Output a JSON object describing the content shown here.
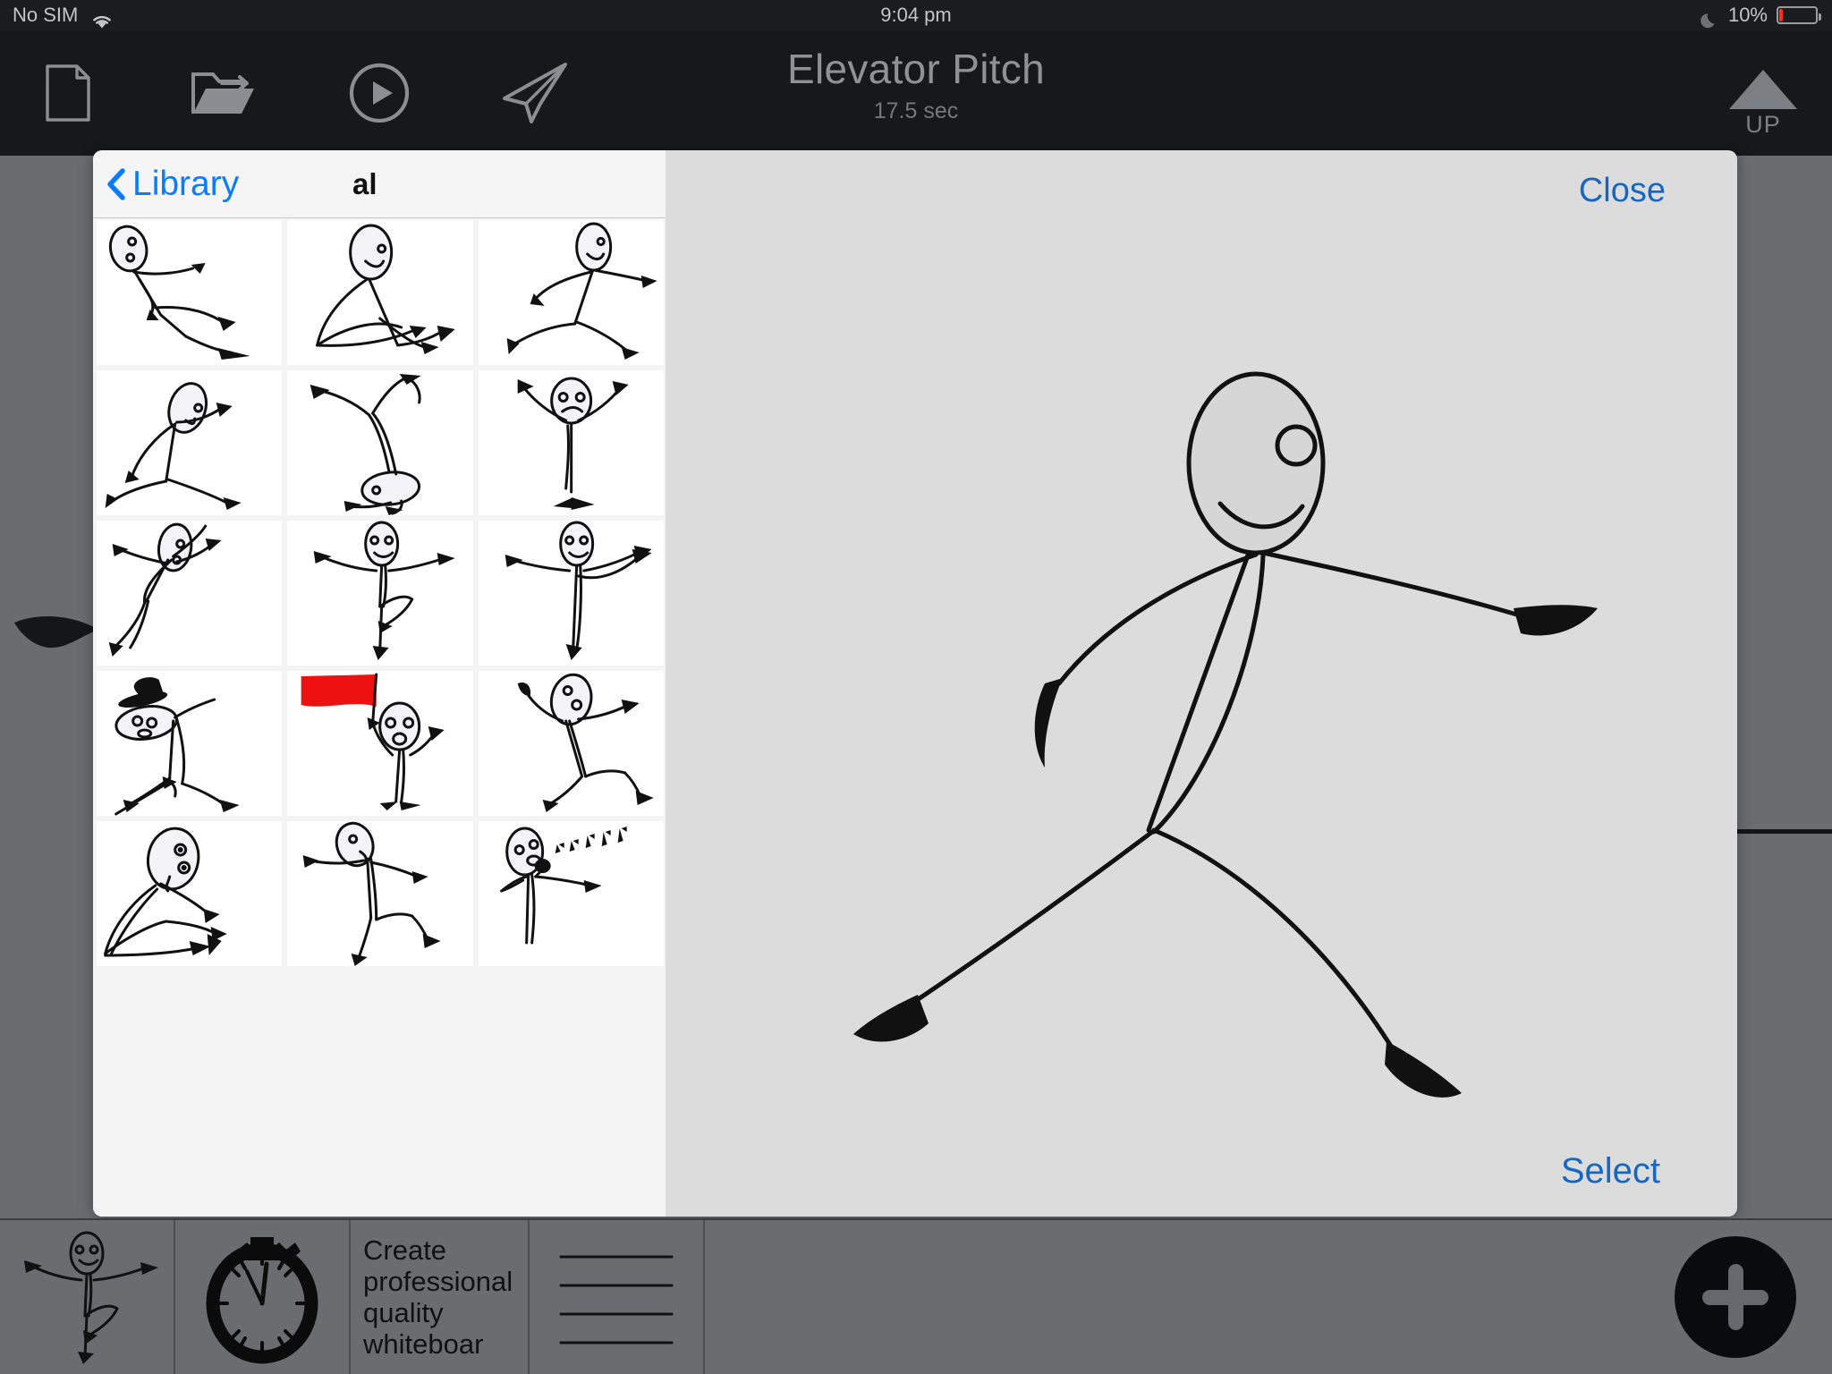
{
  "statusbar": {
    "carrier": "No SIM",
    "time": "9:04 pm",
    "battery_percent": "10%",
    "battery_level": 10,
    "wifi_icon": "wifi-icon",
    "dnd_icon": "moon-icon",
    "battery_icon": "battery-icon"
  },
  "toolbar": {
    "new_icon": "new-document-icon",
    "open_icon": "open-folder-icon",
    "play_icon": "play-circle-icon",
    "send_icon": "paper-plane-icon",
    "up_label": "UP",
    "up_icon": "triangle-up-icon"
  },
  "document": {
    "title": "Elevator Pitch",
    "duration": "17.5 sec"
  },
  "modal": {
    "back_label": "Library",
    "back_icon": "chevron-left-icon",
    "panel_title": "al",
    "close_label": "Close",
    "select_label": "Select",
    "accent_blue": "#0a7cff",
    "action_blue": "#1667c4",
    "thumbnails": [
      {
        "id": "thumb-1",
        "name": "falling-back-figure"
      },
      {
        "id": "thumb-2",
        "name": "sitting-figure"
      },
      {
        "id": "thumb-3",
        "name": "running-figure"
      },
      {
        "id": "thumb-4",
        "name": "leaning-run-figure"
      },
      {
        "id": "thumb-5",
        "name": "handstand-figure"
      },
      {
        "id": "thumb-6",
        "name": "arms-up-sad-figure"
      },
      {
        "id": "thumb-7",
        "name": "striding-figure"
      },
      {
        "id": "thumb-8",
        "name": "dancing-figure"
      },
      {
        "id": "thumb-9",
        "name": "arabesque-figure"
      },
      {
        "id": "thumb-10",
        "name": "top-hat-cane-figure"
      },
      {
        "id": "thumb-11",
        "name": "red-flag-figure"
      },
      {
        "id": "thumb-12",
        "name": "kicking-figure"
      },
      {
        "id": "thumb-13",
        "name": "seated-figure"
      },
      {
        "id": "thumb-14",
        "name": "back-kick-figure"
      },
      {
        "id": "thumb-15",
        "name": "singing-microphone-figure"
      }
    ],
    "preview": {
      "name": "running-stick-figure-preview"
    }
  },
  "timeline": {
    "cells": [
      {
        "type": "figure",
        "name": "timeline-figure-cell",
        "text": ""
      },
      {
        "type": "icon",
        "name": "timeline-stopwatch-cell",
        "text": ""
      },
      {
        "type": "text",
        "name": "timeline-text-cell",
        "text": "Create professional quality whiteboar"
      },
      {
        "type": "lines",
        "name": "timeline-lines-cell",
        "text": ""
      }
    ],
    "add_label": "add-button",
    "add_icon": "plus-icon"
  },
  "colors": {
    "status_bg": "#1a1c20",
    "toolbar_bg": "#16181c",
    "canvas_bg": "#6a6c70",
    "modal_bg": "#dcdcdc",
    "grid_bg": "#f4f4f4",
    "battery_red": "#ff2d20",
    "flag_red": "#ee1111"
  }
}
